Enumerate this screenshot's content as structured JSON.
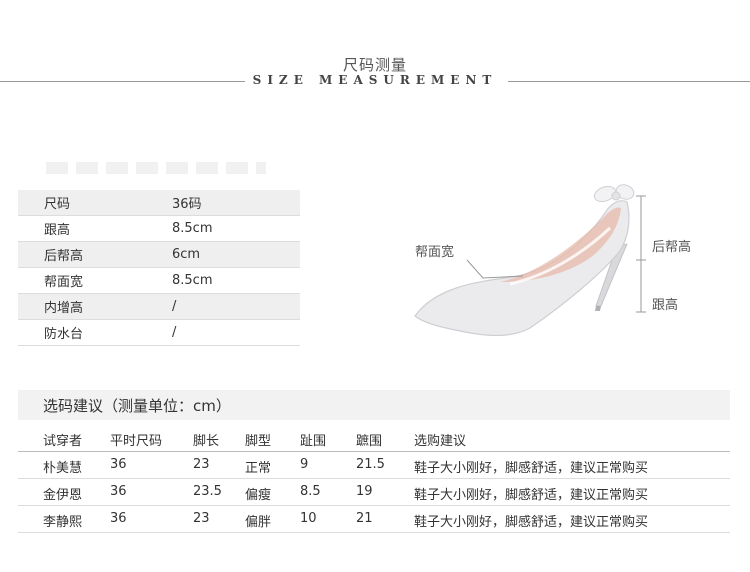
{
  "title": {
    "cn": "尺码测量",
    "en": "SIZE MEASUREMENT"
  },
  "specs": [
    {
      "label": "尺码",
      "value": "36码"
    },
    {
      "label": "跟高",
      "value": "8.5cm"
    },
    {
      "label": "后帮高",
      "value": "6cm"
    },
    {
      "label": "帮面宽",
      "value": "8.5cm"
    },
    {
      "label": "内增高",
      "value": "/"
    },
    {
      "label": "防水台",
      "value": "/"
    }
  ],
  "callouts": {
    "upper_width": "帮面宽",
    "back_height": "后帮高",
    "heel_height": "跟高"
  },
  "recommendation": {
    "title": "选码建议（测量单位：cm）",
    "columns": [
      "试穿者",
      "平时尺码",
      "脚长",
      "脚型",
      "趾围",
      "蹠围",
      "选购建议"
    ],
    "rows": [
      [
        "朴美慧",
        "36",
        "23",
        "正常",
        "9",
        "21.5",
        "鞋子大小刚好，脚感舒适，建议正常购买"
      ],
      [
        "金伊恩",
        "36",
        "23.5",
        "偏瘦",
        "8.5",
        "19",
        "鞋子大小刚好，脚感舒适，建议正常购买"
      ],
      [
        "李静熙",
        "36",
        "23",
        "偏胖",
        "10",
        "21",
        "鞋子大小刚好，脚感舒适，建议正常购买"
      ]
    ]
  },
  "colors": {
    "row_shade": "#efefef",
    "line": "#dddddd",
    "shoe": "#e6e6e8",
    "shoe_lining": "#e8b8a8"
  }
}
